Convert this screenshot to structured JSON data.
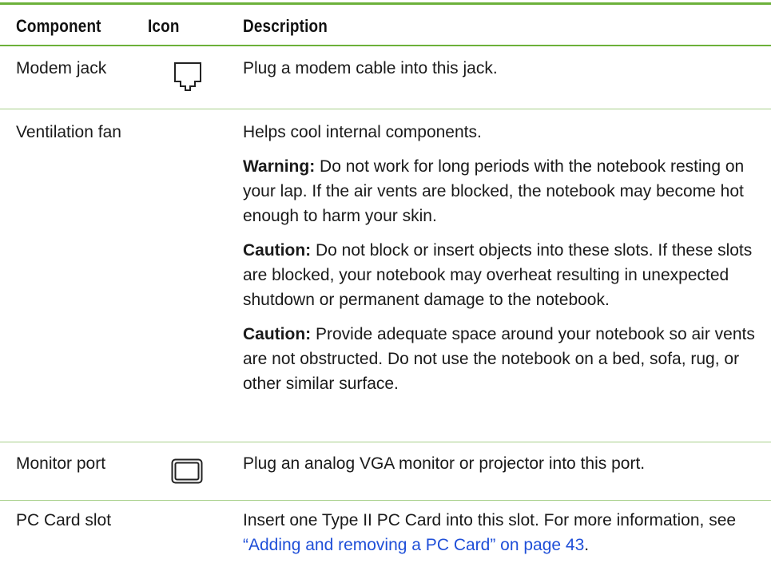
{
  "headers": {
    "component": "Component",
    "icon": "Icon",
    "description": "Description"
  },
  "rows": [
    {
      "component": "Modem jack",
      "icon": "modem-jack-icon",
      "paragraphs": [
        {
          "text": "Plug a modem cable into this jack."
        }
      ]
    },
    {
      "component": "Ventilation fan",
      "icon": "",
      "paragraphs": [
        {
          "text": "Helps cool internal components."
        },
        {
          "label": "Warning:",
          "text": " Do not work for long periods with the notebook resting on your lap. If the air vents are blocked, the notebook may become hot enough to harm your skin."
        },
        {
          "label": "Caution:",
          "text": " Do not block or insert objects into these slots. If these slots are blocked, your notebook may overheat resulting in unexpected shutdown or permanent damage to the notebook."
        },
        {
          "label": "Caution:",
          "text": " Provide adequate space around your notebook so air vents are not obstructed. Do not use the notebook on a bed, sofa, rug, or other similar surface."
        }
      ]
    },
    {
      "component": "Monitor port",
      "icon": "monitor-port-icon",
      "paragraphs": [
        {
          "text": "Plug an analog VGA monitor or projector into this port."
        }
      ]
    },
    {
      "component": "PC Card slot",
      "icon": "",
      "paragraphs": [
        {
          "text": "Insert one Type II PC Card into this slot. For more information, see ",
          "link": "“Adding and removing a PC Card” on page 43",
          "after": "."
        }
      ]
    }
  ],
  "colors": {
    "rule": "#6cb13a",
    "link": "#1f4fd8"
  }
}
